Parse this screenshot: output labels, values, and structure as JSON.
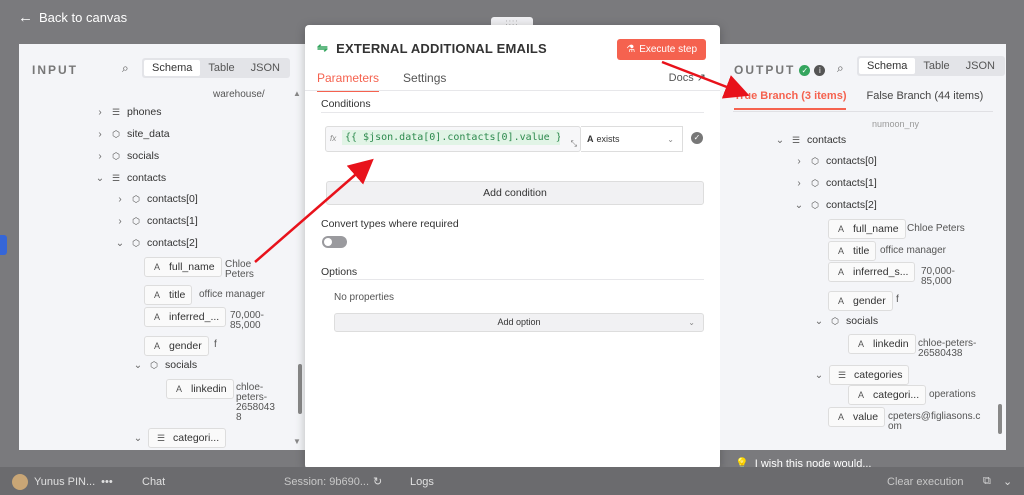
{
  "top": {
    "back_label": "Back to canvas",
    "drag_handle": "::::"
  },
  "input_panel": {
    "title": "INPUT",
    "view_tabs": [
      "Schema",
      "Table",
      "JSON"
    ],
    "active_view": "Schema",
    "partial_text": "warehouse/",
    "tree": [
      {
        "label": "phones",
        "type": "list"
      },
      {
        "label": "site_data",
        "type": "object"
      },
      {
        "label": "socials",
        "type": "object"
      },
      {
        "label": "contacts",
        "type": "list"
      },
      {
        "label": "contacts[0]",
        "type": "object"
      },
      {
        "label": "contacts[1]",
        "type": "object"
      },
      {
        "label": "contacts[2]",
        "type": "object"
      },
      {
        "label": "full_name",
        "type": "string",
        "value": "Chloe\nPeters"
      },
      {
        "label": "title",
        "type": "string",
        "value": "office manager"
      },
      {
        "label": "inferred_...",
        "type": "string",
        "value": "70,000-\n85,000"
      },
      {
        "label": "gender",
        "type": "string",
        "value": "f"
      },
      {
        "label": "socials",
        "type": "object"
      },
      {
        "label": "linkedin",
        "type": "string",
        "value": "chloe-\npeters-\n2658043\n8"
      },
      {
        "label": "categori...",
        "type": "list"
      }
    ]
  },
  "node_panel": {
    "title": "EXTERNAL ADDITIONAL EMAILS",
    "execute_label": "Execute step",
    "tabs": [
      "Parameters",
      "Settings"
    ],
    "active_tab": "Parameters",
    "docs_label": "Docs",
    "conditions_label": "Conditions",
    "condition": {
      "expression": "{{ $json.data[0].contacts[0].value }}",
      "operator": "exists"
    },
    "add_condition_label": "Add condition",
    "convert_types_label": "Convert types where required",
    "convert_types_enabled": false,
    "options_label": "Options",
    "no_properties_label": "No properties",
    "add_option_label": "Add option"
  },
  "output_panel": {
    "title": "OUTPUT",
    "view_tabs": [
      "Schema",
      "Table",
      "JSON"
    ],
    "active_view": "Schema",
    "branch_tabs": [
      "True Branch (3 items)",
      "False Branch (44 items)"
    ],
    "active_branch": "True Branch (3 items)",
    "partial_text": "numoon_ny",
    "tree": [
      {
        "label": "contacts",
        "type": "list"
      },
      {
        "label": "contacts[0]",
        "type": "object"
      },
      {
        "label": "contacts[1]",
        "type": "object"
      },
      {
        "label": "contacts[2]",
        "type": "object"
      },
      {
        "label": "full_name",
        "type": "string",
        "value": "Chloe Peters"
      },
      {
        "label": "title",
        "type": "string",
        "value": "office manager"
      },
      {
        "label": "inferred_s...",
        "type": "string",
        "value": "70,000-\n85,000"
      },
      {
        "label": "gender",
        "type": "string",
        "value": "f"
      },
      {
        "label": "socials",
        "type": "object"
      },
      {
        "label": "linkedin",
        "type": "string",
        "value": "chloe-peters-\n26580438"
      },
      {
        "label": "categories",
        "type": "list"
      },
      {
        "label": "categori...",
        "type": "string",
        "value": "operations"
      },
      {
        "label": "value",
        "type": "string",
        "value": "cpeters@figliasons.c\nom"
      }
    ]
  },
  "feedback_hint": "I wish this node would...",
  "bottom_bar": {
    "user": "Yunus PIN...",
    "more": "•••",
    "chat": "Chat",
    "session": "Session: 9b690...",
    "logs": "Logs",
    "clear": "Clear execution"
  },
  "colors": {
    "accent": "#f5624f",
    "success": "#35a55e",
    "expr_green": "#2d8a4e",
    "annotation_arrow": "#e8121b"
  }
}
